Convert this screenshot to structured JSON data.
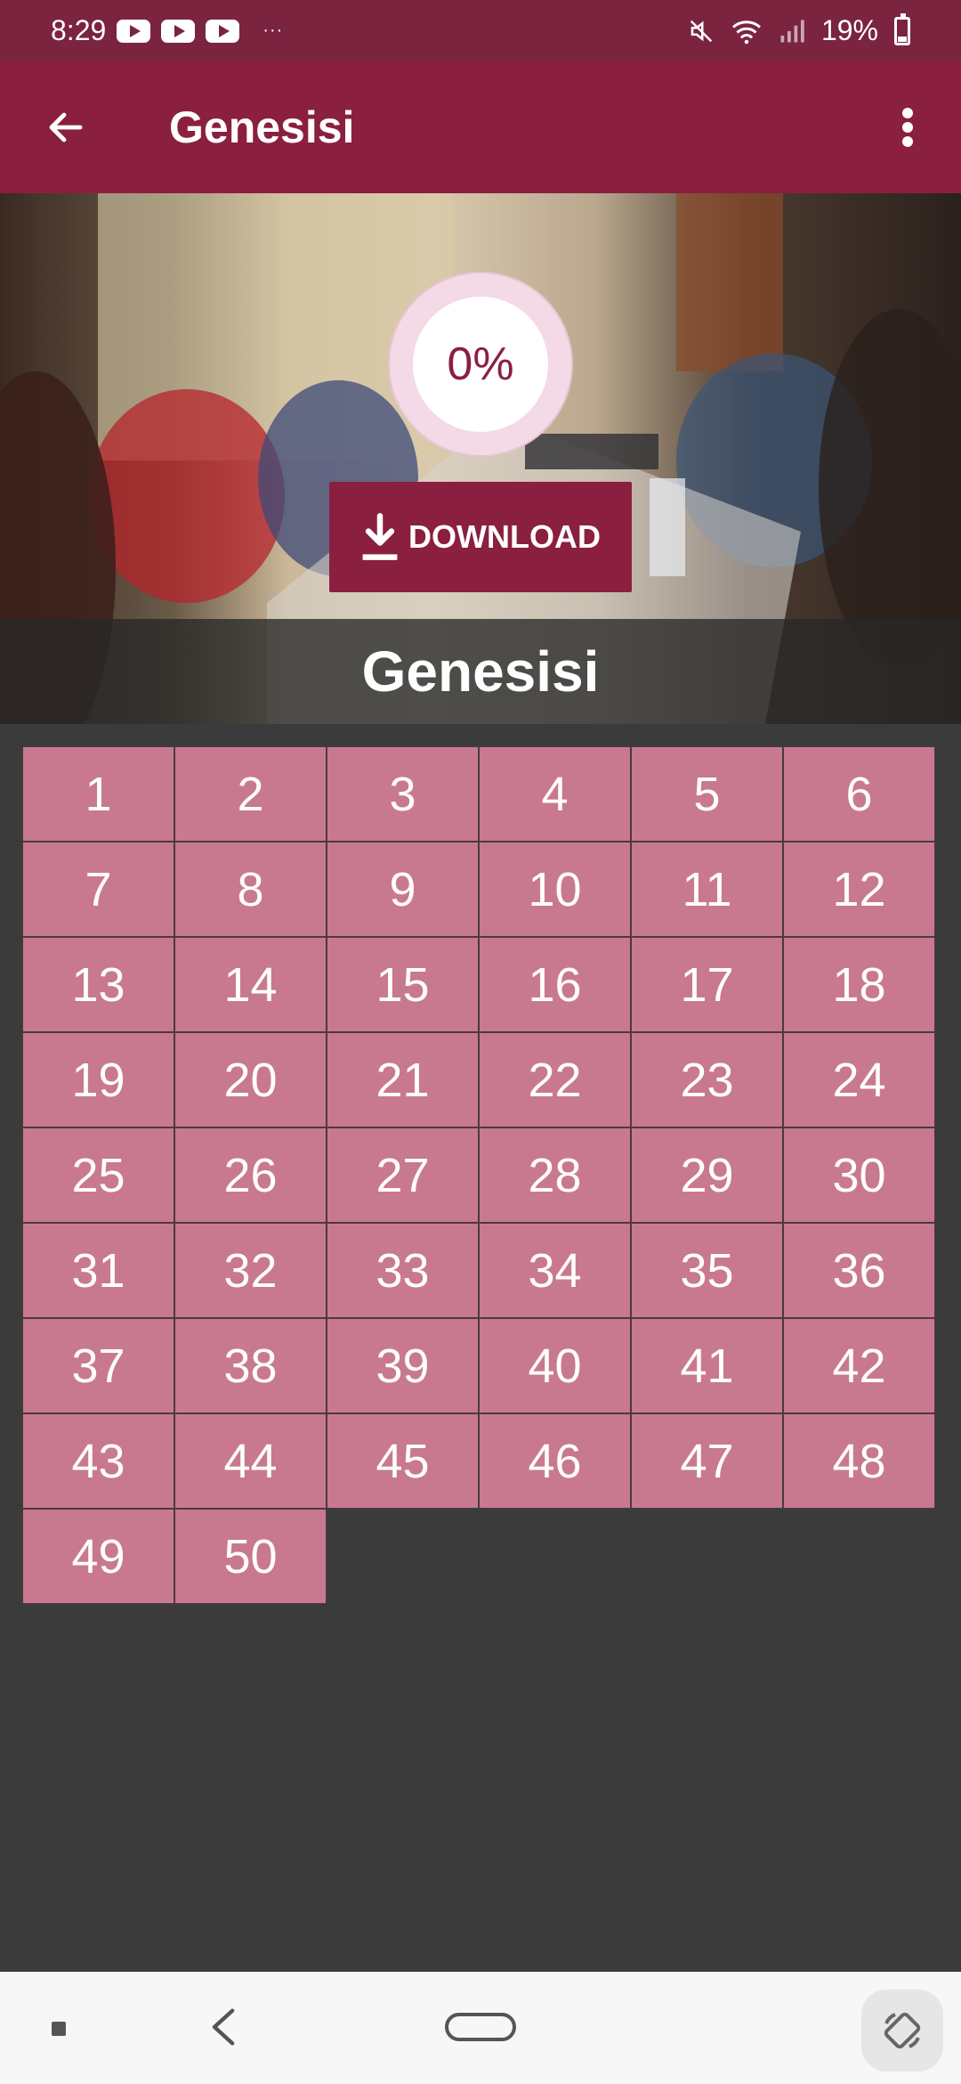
{
  "status_bar": {
    "time": "8:29",
    "dots": "···",
    "battery": "19%",
    "icons": [
      "youtube-icon",
      "youtube-icon",
      "youtube-icon",
      "mute-icon",
      "wifi-icon",
      "signal-icon",
      "battery-icon"
    ]
  },
  "app_bar": {
    "title": "Genesisi",
    "icons": [
      "back-arrow-icon",
      "more-vert-icon"
    ]
  },
  "hero": {
    "progress": "0%",
    "progress_value": 0,
    "download_label": "DOWNLOAD",
    "caption": "Genesisi"
  },
  "chapters": [
    "1",
    "2",
    "3",
    "4",
    "5",
    "6",
    "7",
    "8",
    "9",
    "10",
    "11",
    "12",
    "13",
    "14",
    "15",
    "16",
    "17",
    "18",
    "19",
    "20",
    "21",
    "22",
    "23",
    "24",
    "25",
    "26",
    "27",
    "28",
    "29",
    "30",
    "31",
    "32",
    "33",
    "34",
    "35",
    "36",
    "37",
    "38",
    "39",
    "40",
    "41",
    "42",
    "43",
    "44",
    "45",
    "46",
    "47",
    "48",
    "49",
    "50"
  ],
  "colors": {
    "status_bar": "#7a2440",
    "app_bar": "#8b1f3f",
    "chapter_cell": "#c9798f",
    "background": "#3b3b3b"
  }
}
